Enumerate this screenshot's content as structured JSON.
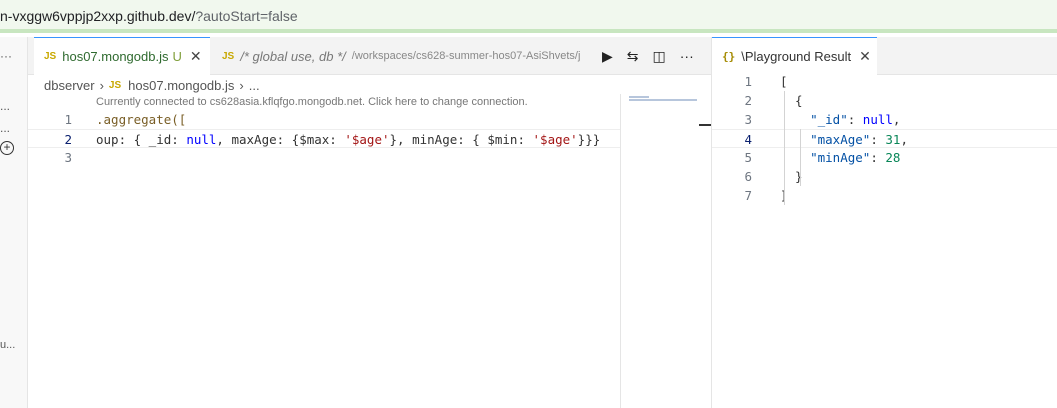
{
  "browser": {
    "url_main": "n-vxggw6vppjp2xxp.github.dev/",
    "url_query": "?autoStart=false"
  },
  "sidestrip": {
    "dots": [
      "···",
      "...",
      "..."
    ],
    "trunc": "u..."
  },
  "editor_group_1": {
    "tabs": [
      {
        "label": "hos07.mongodb.js",
        "badge": "U",
        "icon": "JS",
        "active": true
      },
      {
        "label": "/* global use, db */",
        "path": "/workspaces/cs628-summer-hos07-AsiShvets/j",
        "icon": "JS",
        "active": false
      }
    ],
    "toolbar_icons": [
      "run-icon",
      "compare-icon",
      "split-editor-icon",
      "more-icon"
    ],
    "toolbar_glyphs": {
      "run": "▶",
      "compare": "⇆",
      "split": "◫",
      "more": "···"
    },
    "breadcrumb": {
      "folder": "dbserver",
      "file_icon": "JS",
      "file": "hos07.mongodb.js",
      "tail": "..."
    },
    "codelens": "Currently connected to cs628asia.kflqfgo.mongodb.net. Click here to change connection.",
    "lines": [
      {
        "n": "1",
        "segments": [
          {
            "t": ".aggregate([",
            "c": "kw"
          }
        ]
      },
      {
        "n": "2",
        "segments": [
          {
            "t": "oup: { _id: ",
            "c": "plain"
          },
          {
            "t": "null",
            "c": "nul"
          },
          {
            "t": ", maxAge: {$max: ",
            "c": "plain"
          },
          {
            "t": "'$age'",
            "c": "str"
          },
          {
            "t": "}, minAge: { $min: ",
            "c": "plain"
          },
          {
            "t": "'$age'",
            "c": "str"
          },
          {
            "t": "}}}",
            "c": "plain"
          }
        ]
      },
      {
        "n": "3",
        "segments": []
      }
    ]
  },
  "editor_group_2": {
    "tab": {
      "label": "\\Playground Result",
      "icon": "{}"
    },
    "lines": [
      {
        "n": "1",
        "segments": [
          {
            "t": "[",
            "c": "plain"
          }
        ]
      },
      {
        "n": "2",
        "segments": [
          {
            "t": "  {",
            "c": "plain"
          }
        ]
      },
      {
        "n": "3",
        "segments": [
          {
            "t": "    \"_id\"",
            "c": "jkey"
          },
          {
            "t": ": ",
            "c": "plain"
          },
          {
            "t": "null",
            "c": "jnul"
          },
          {
            "t": ",",
            "c": "plain"
          }
        ]
      },
      {
        "n": "4",
        "segments": [
          {
            "t": "    \"maxAge\"",
            "c": "jkey"
          },
          {
            "t": ": ",
            "c": "plain"
          },
          {
            "t": "31",
            "c": "jnum"
          },
          {
            "t": ",",
            "c": "plain"
          }
        ]
      },
      {
        "n": "5",
        "segments": [
          {
            "t": "    \"minAge\"",
            "c": "jkey"
          },
          {
            "t": ": ",
            "c": "plain"
          },
          {
            "t": "28",
            "c": "jnum"
          }
        ]
      },
      {
        "n": "6",
        "segments": [
          {
            "t": "  }",
            "c": "plain"
          }
        ]
      },
      {
        "n": "7",
        "segments": [
          {
            "t": "]",
            "c": "plain"
          }
        ]
      }
    ]
  }
}
